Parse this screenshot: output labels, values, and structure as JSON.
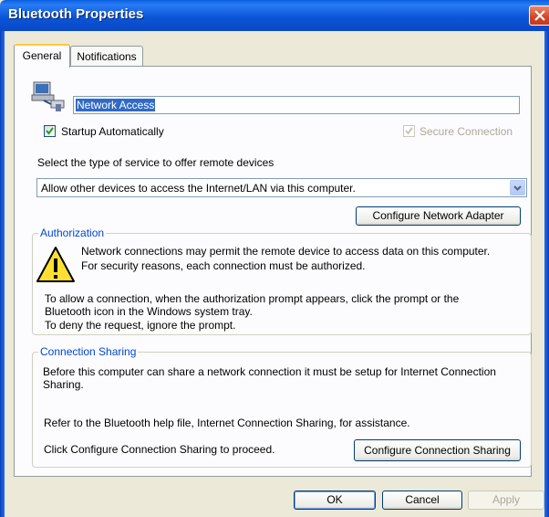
{
  "window": {
    "title": "Bluetooth Properties"
  },
  "tabs": [
    {
      "label": "General"
    },
    {
      "label": "Notifications"
    }
  ],
  "service": {
    "name_value": "Network Access",
    "startup_label": "Startup Automatically",
    "startup_checked": true,
    "secure_label": "Secure Connection",
    "secure_checked": true
  },
  "service_type": {
    "prompt": "Select the type of service to offer remote devices",
    "selected": "Allow other devices to access the Internet/LAN via this computer.",
    "configure_adapter_label": "Configure Network Adapter"
  },
  "authorization": {
    "group_label": "Authorization",
    "line1": "Network connections may permit the remote device to access data on this computer.",
    "line2": "For security reasons, each connection must be authorized.",
    "line3": "To allow a connection, when the authorization prompt appears, click the prompt or the",
    "line4": "Bluetooth icon in the Windows system tray.",
    "line5": "To deny the request, ignore the prompt."
  },
  "sharing": {
    "group_label": "Connection Sharing",
    "line1": "Before this computer can share a network connection it must be setup for Internet Connection",
    "line2": "Sharing.",
    "line3": "Refer to the Bluetooth help file, Internet Connection Sharing, for assistance.",
    "line4": "Click Configure Connection Sharing to proceed.",
    "configure_sharing_label": "Configure Connection Sharing"
  },
  "footer": {
    "ok_label": "OK",
    "cancel_label": "Cancel",
    "apply_label": "Apply"
  }
}
